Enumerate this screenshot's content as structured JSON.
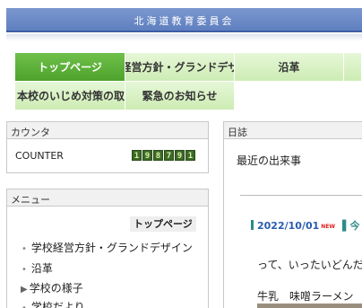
{
  "header": {
    "org_name": "北海道教育委員会"
  },
  "nav": {
    "row1": [
      "トップページ",
      "学校経営方針・グランドデザイン",
      "沿革"
    ],
    "row2": [
      "本校のいじめ対策の取組",
      "緊急のお知らせ"
    ]
  },
  "counter": {
    "title": "カウンタ",
    "label": "COUNTER",
    "digits": [
      "1",
      "9",
      "8",
      "7",
      "9",
      "1"
    ]
  },
  "menu": {
    "title": "メニュー",
    "top_link": "トップページ",
    "items": [
      {
        "bullet": "•",
        "label": "学校経営方針・グランドデザイン"
      },
      {
        "bullet": "•",
        "label": "沿革"
      },
      {
        "bullet": "▶",
        "label": "学校の様子"
      },
      {
        "bullet": "•",
        "label": "学校だより"
      }
    ]
  },
  "diary": {
    "title": "日誌",
    "subtitle": "最近の出来事",
    "post_date": "2022/10/01",
    "new_badge": "NEW",
    "next_prefix": "今",
    "text_line1": "って、いったいどんだ",
    "text_line2": "牛乳　味噌ラーメン"
  },
  "colors": {
    "banner": "#5f7fbf",
    "nav_active": "#4ea32c",
    "nav_bg": "#d6efc0",
    "accent": "#2f8a8a",
    "new": "#e0201a"
  }
}
